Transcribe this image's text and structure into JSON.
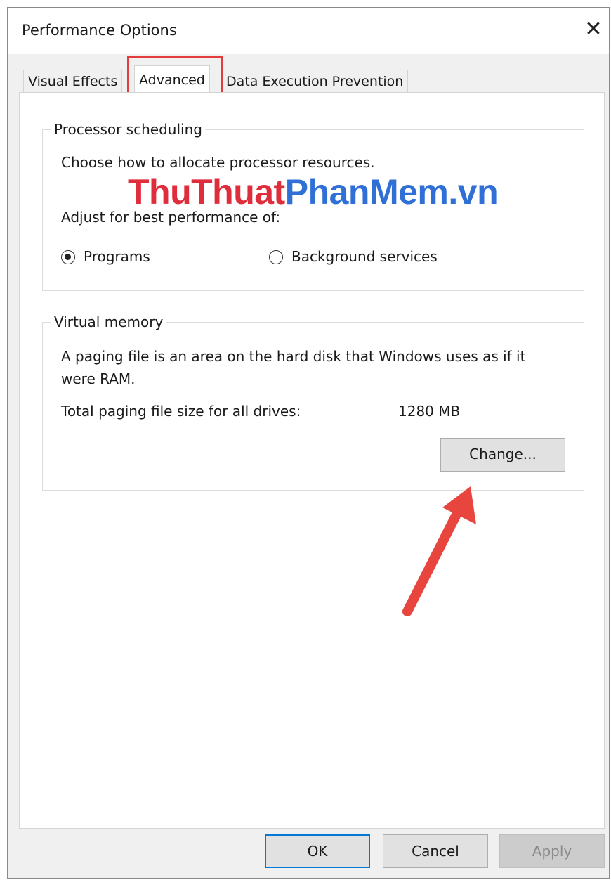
{
  "window": {
    "title": "Performance Options",
    "close_glyph": "✕"
  },
  "tabs": [
    {
      "label": "Visual Effects",
      "active": false
    },
    {
      "label": "Advanced",
      "active": true
    },
    {
      "label": "Data Execution Prevention",
      "active": false
    }
  ],
  "processor_scheduling": {
    "legend": "Processor scheduling",
    "description": "Choose how to allocate processor resources.",
    "adjust_label": "Adjust for best performance of:",
    "options": [
      {
        "label": "Programs",
        "checked": true
      },
      {
        "label": "Background services",
        "checked": false
      }
    ]
  },
  "watermark": {
    "part1": "ThuThuat",
    "part2": "PhanMem",
    "part3": ".vn"
  },
  "virtual_memory": {
    "legend": "Virtual memory",
    "description_line1": "A paging file is an area on the hard disk that Windows uses as if it",
    "description_line2": "were RAM.",
    "total_label": "Total paging file size for all drives:",
    "total_value": "1280 MB",
    "change_button": "Change..."
  },
  "footer": {
    "ok": "OK",
    "cancel": "Cancel",
    "apply": "Apply"
  },
  "colors": {
    "highlight": "#e23c3c",
    "arrow": "#e8453f",
    "watermark_red": "#e02d3c",
    "watermark_blue": "#2f6fd6",
    "default_button_border": "#0078d7"
  },
  "icons": {
    "close": "close-icon",
    "annotation_arrow": "arrow-icon"
  }
}
